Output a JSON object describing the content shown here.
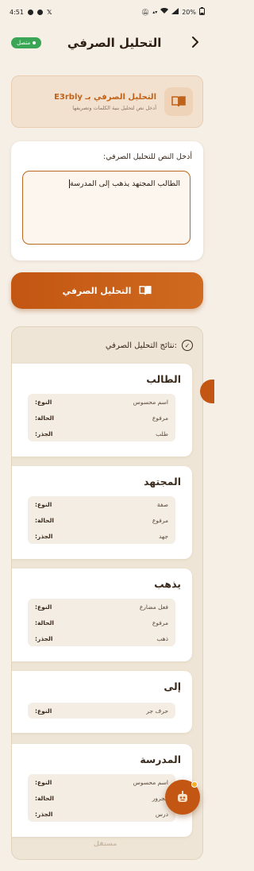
{
  "status_bar": {
    "time": "4:51",
    "battery": "20%",
    "left_icons": [
      "message-icon",
      "notification-icon",
      "x-icon"
    ],
    "right_icons": [
      "mute-icon",
      "data-icon",
      "wifi-icon",
      "signal-icon",
      "battery-icon"
    ]
  },
  "header": {
    "title": "التحليل الصرفي",
    "online_badge": "متصل",
    "back_icon": "chevron-right-icon"
  },
  "info_card": {
    "title": "التحليل الصرفي بـ E3rbly",
    "subtitle": "أدخل نص لتحليل بنية الكلمات وتصريفها",
    "icon": "book-icon"
  },
  "input": {
    "label": "أدخل النص للتحليل الصرفي:",
    "value": "الطالب المجتهد يذهب إلى المدرسة"
  },
  "analyze_button": {
    "label": "التحليل الصرفي",
    "icon": "book-icon"
  },
  "results": {
    "title": "نتائج التحليل الصرفي:",
    "icon": "check-circle-icon",
    "words": [
      {
        "word": "الطالب",
        "rows": [
          {
            "key": "النوع:",
            "value": "اسم محسوس"
          },
          {
            "key": "الحالة:",
            "value": "مرفوع"
          },
          {
            "key": "الجذر:",
            "value": "طلب"
          }
        ]
      },
      {
        "word": "المجتهد",
        "rows": [
          {
            "key": "النوع:",
            "value": "صفة"
          },
          {
            "key": "الحالة:",
            "value": "مرفوع"
          },
          {
            "key": "الجذر:",
            "value": "جهد"
          }
        ]
      },
      {
        "word": "يذهب",
        "rows": [
          {
            "key": "النوع:",
            "value": "فعل مضارع"
          },
          {
            "key": "الحالة:",
            "value": "مرفوع"
          },
          {
            "key": "الجذر:",
            "value": "ذهب"
          }
        ]
      },
      {
        "word": "إلى",
        "rows": [
          {
            "key": "النوع:",
            "value": "حرف جر"
          }
        ]
      },
      {
        "word": "المدرسة",
        "rows": [
          {
            "key": "النوع:",
            "value": "اسم محسوس"
          },
          {
            "key": "الحالة:",
            "value": "مجرور"
          },
          {
            "key": "الجذر:",
            "value": "درس"
          }
        ]
      }
    ]
  },
  "fab": {
    "icon": "robot-icon"
  },
  "watermark": "مستقل",
  "colors": {
    "accent": "#c35612",
    "background": "#f5efe6",
    "online": "#3aa655"
  }
}
